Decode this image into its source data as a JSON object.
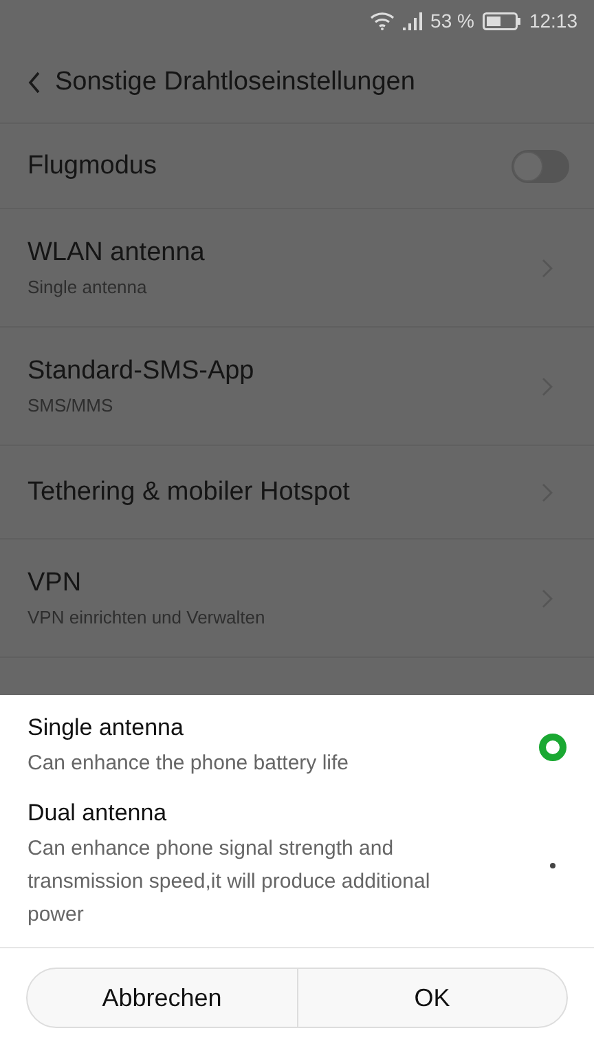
{
  "status_bar": {
    "battery_text": "53 %",
    "time": "12:13"
  },
  "header": {
    "title": "Sonstige Drahtloseinstellungen"
  },
  "settings": [
    {
      "kind": "toggle",
      "title": "Flugmodus",
      "on": false
    },
    {
      "kind": "nav",
      "title": "WLAN antenna",
      "subtitle": "Single antenna"
    },
    {
      "kind": "nav",
      "title": "Standard-SMS-App",
      "subtitle": "SMS/MMS"
    },
    {
      "kind": "nav",
      "title": "Tethering & mobiler Hotspot"
    },
    {
      "kind": "nav",
      "title": "VPN",
      "subtitle": "VPN einrichten und Verwalten"
    }
  ],
  "dialog": {
    "options": [
      {
        "title": "Single antenna",
        "description": "Can enhance the phone battery life",
        "selected": true
      },
      {
        "title": "Dual antenna",
        "description": "Can enhance phone signal strength and transmission speed,it will produce additional power",
        "selected": false
      }
    ],
    "buttons": [
      "Abbrechen",
      "OK"
    ]
  }
}
